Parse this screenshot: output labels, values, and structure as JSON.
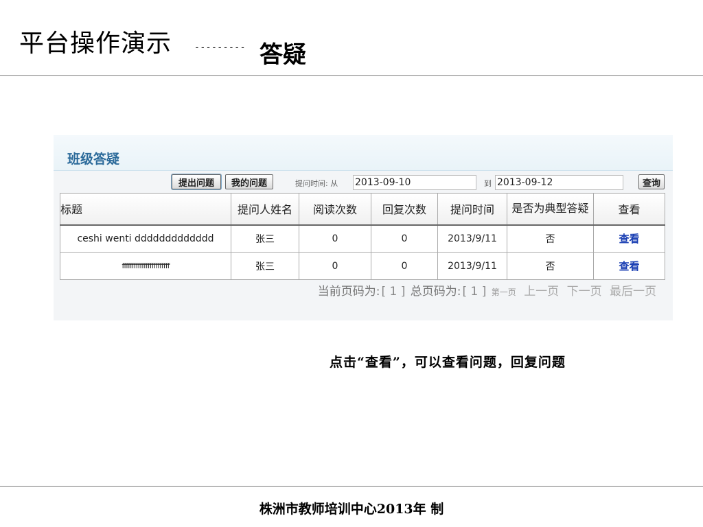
{
  "slide": {
    "title": "平台操作演示",
    "dashes": "---------",
    "subtitle": "答疑",
    "caption": "点击“查看”，可以查看问题，回复问题",
    "footer": "株洲市教师培训中心2013年  制"
  },
  "panel": {
    "title": "班级答疑",
    "toolbar": {
      "ask_button": "提出问题",
      "my_questions_button": "我的问题",
      "from_label": "提问时间: 从",
      "from_value": "2013-09-10",
      "to_label": "到",
      "to_value": "2013-09-12",
      "search_button": "查询"
    },
    "table": {
      "headers": [
        "标题",
        "提问人姓名",
        "阅读次数",
        "回复次数",
        "提问时间",
        "是否为典型答疑",
        "查看"
      ],
      "rows": [
        [
          "ceshi wenti ddddddddddddd",
          "张三",
          "0",
          "0",
          "2013/9/11",
          "否",
          "查看"
        ],
        [
          "ffffffffffffffffffffffff",
          "张三",
          "0",
          "0",
          "2013/9/11",
          "否",
          "查看"
        ]
      ]
    },
    "pager": {
      "current_label": "当前页码为:",
      "current_value": "[ 1 ]",
      "total_label": "总页码为:",
      "total_value": "[ 1 ]",
      "first": "第一页",
      "prev": "上一页",
      "next": "下一页",
      "last": "最后一页"
    }
  }
}
